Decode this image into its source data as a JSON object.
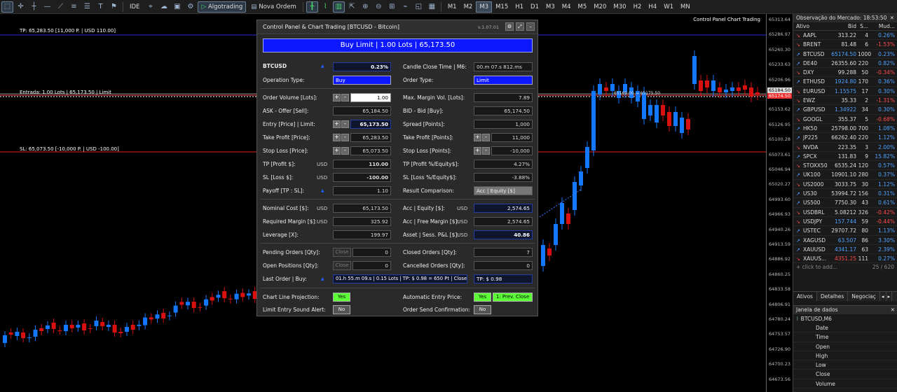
{
  "toolbar": {
    "algotrading": "Algotrading",
    "nova_ordem": "Nova Ordem",
    "ide": "IDE",
    "timeframes": [
      "M1",
      "M2",
      "M3",
      "M15",
      "H1",
      "D1",
      "M3",
      "M4",
      "M5",
      "M20",
      "M30",
      "H2",
      "H4",
      "W1",
      "MN"
    ],
    "active_timeframe": "M3"
  },
  "chart": {
    "title": "Control Panel Chart Trading",
    "tp_line": "TP: 65,283.50 [11,000 P. | USD 110.00]",
    "entry_line": "Entrada: 1.00 Lots | 65,173.50 | Limit",
    "sl_line": "SL: 65,073.50 [-10,000 P. | USD -100.00]",
    "marker_text": "65169.00 → 65175.50",
    "price_labels": [
      "65313.64",
      "65286.97",
      "65260.30",
      "65233.63",
      "65206.96",
      "65180.29",
      "65153.62",
      "65126.95",
      "65100.28",
      "65073.61",
      "65046.94",
      "65020.27",
      "64993.60",
      "64966.93",
      "64940.26",
      "64913.59",
      "64886.92",
      "64860.25",
      "64833.58",
      "64806.91",
      "64780.24",
      "64753.57",
      "64726.90",
      "64700.23",
      "64673.56"
    ],
    "tag_bid": "65184.50",
    "tag_ask": "65174.50"
  },
  "panel": {
    "title": "Control Panel & Chart Trading [BTCUSD - Bitcoin]",
    "version": "v.1.07.01",
    "main_button": "Buy Limit  |  1.00 Lots  |  65,173.50",
    "symbol": "BTCUSD",
    "change": "0.23%",
    "candle_close_label": "Candle Close Time | M6:",
    "candle_close_value": "00.m 07.s 812.ms",
    "operation_type_label": "Operation Type:",
    "operation_type_value": "Buy",
    "order_type_label": "Order Type:",
    "order_type_value": "Limit",
    "order_volume_label": "Order Volume [Lots]:",
    "order_volume_value": "1.00",
    "max_margin_label": "Max. Margin Vol. [Lots]:",
    "max_margin_value": "7.89",
    "ask_label": "ASK - Offer [Sell]:",
    "ask_value": "65,184.50",
    "bid_label": "BID - Bid [Buy]:",
    "bid_value": "65,174.50",
    "entry_label": "Entry [Price] | Limit:",
    "entry_value": "65,173.50",
    "spread_label": "Spread [Points]:",
    "spread_value": "1,000",
    "tp_price_label": "Take Profit [Price]:",
    "tp_price_value": "65,283.50",
    "tp_points_label": "Take Profit [Points]:",
    "tp_points_value": "11,000",
    "sl_price_label": "Stop Loss [Price]:",
    "sl_price_value": "65,073.50",
    "sl_points_label": "Stop Loss [Points]:",
    "sl_points_value": "-10,000",
    "tp_profit_label": "TP [Profit $]:",
    "tp_profit_value": "110.00",
    "tp_pct_label": "TP [Profit %/Equity$]:",
    "tp_pct_value": "4.27%",
    "sl_loss_label": "SL [Loss $]:",
    "sl_loss_value": "-100.00",
    "sl_pct_label": "SL [Loss %/Equity$]:",
    "sl_pct_value": "-3.88%",
    "payoff_label": "Payoff [TP : SL]:",
    "payoff_value": "1.10",
    "result_comp_label": "Result Comparison:",
    "result_comp_value": "Acc | Equity [$]",
    "nominal_label": "Nominal Cost [$]:",
    "nominal_value": "65,173.50",
    "acc_equity_label": "Acc | Equity [$]:",
    "acc_equity_value": "2,574.65",
    "req_margin_label": "Required Margin [$]:",
    "req_margin_value": "325.92",
    "free_margin_label": "Acc | Free Margin [$]:",
    "free_margin_value": "2,574.65",
    "leverage_label": "Leverage [X]:",
    "leverage_value": "199.97",
    "asset_pl_label": "Asset | Sess. P&L [$]:",
    "asset_pl_value": "40.86",
    "pending_label": "Pending Orders [Qty]:",
    "pending_value": "0",
    "closed_label": "Closed Orders [Qty]:",
    "closed_value": "7",
    "open_pos_label": "Open Positions [Qty]:",
    "open_pos_value": "0",
    "cancelled_label": "Cancelled Orders [Qty]:",
    "cancelled_value": "0",
    "last_order_label": "Last Order | Buy:",
    "last_order_value": "01.h 55.m 09.s | 0.15 Lots | TP: $ 0.98 = 650 Pt | Closed",
    "last_order_tp": "TP: $ 0.98",
    "line_proj_label": "Chart Line Projection:",
    "line_proj_value": "Yes",
    "auto_entry_label": "Automatic Entry Price:",
    "auto_entry_value": "Yes",
    "auto_entry_mode": "1: Prev. Close",
    "sound_label": "Limit Entry Sound Alert:",
    "sound_value": "No",
    "confirm_label": "Order Send Confirmation:",
    "confirm_value": "No",
    "close_btn": "Close",
    "usd": "USD"
  },
  "market": {
    "header": "Observação do Mercado: 18:53:50",
    "columns": [
      "Ativo",
      "Bid",
      "S...",
      "Mud..."
    ],
    "rows": [
      {
        "dir": "down",
        "sym": "AAPL",
        "bid": "313.22",
        "s": "4",
        "chg": "0.26%",
        "bidc": "wht",
        "chgc": "up"
      },
      {
        "dir": "down",
        "sym": "BRENT",
        "bid": "81.48",
        "s": "6",
        "chg": "-1.53%",
        "bidc": "wht",
        "chgc": "dn"
      },
      {
        "dir": "up",
        "sym": "BTCUSD",
        "bid": "65174.50",
        "s": "1000",
        "chg": "0.23%",
        "bidc": "up",
        "chgc": "up"
      },
      {
        "dir": "up",
        "sym": "DE40",
        "bid": "26355.60",
        "s": "220",
        "chg": "0.82%",
        "bidc": "wht",
        "chgc": "up"
      },
      {
        "dir": "down",
        "sym": "DXY",
        "bid": "99.288",
        "s": "50",
        "chg": "-0.34%",
        "bidc": "wht",
        "chgc": "dn"
      },
      {
        "dir": "up",
        "sym": "ETHUSD",
        "bid": "1924.80",
        "s": "170",
        "chg": "0.36%",
        "bidc": "up",
        "chgc": "up"
      },
      {
        "dir": "down",
        "sym": "EURUSD",
        "bid": "1.15575",
        "s": "17",
        "chg": "0.30%",
        "bidc": "up",
        "chgc": "up"
      },
      {
        "dir": "down",
        "sym": "EWZ",
        "bid": "35.33",
        "s": "2",
        "chg": "-1.31%",
        "bidc": "wht",
        "chgc": "dn"
      },
      {
        "dir": "up",
        "sym": "GBPUSD",
        "bid": "1.34922",
        "s": "34",
        "chg": "0.30%",
        "bidc": "up",
        "chgc": "up"
      },
      {
        "dir": "down",
        "sym": "GOOGL",
        "bid": "355.37",
        "s": "5",
        "chg": "-0.68%",
        "bidc": "wht",
        "chgc": "dn"
      },
      {
        "dir": "up",
        "sym": "HK50",
        "bid": "25798.00",
        "s": "700",
        "chg": "1.08%",
        "bidc": "wht",
        "chgc": "up"
      },
      {
        "dir": "up",
        "sym": "JP225",
        "bid": "66262.40",
        "s": "220",
        "chg": "1.12%",
        "bidc": "wht",
        "chgc": "up"
      },
      {
        "dir": "down",
        "sym": "NVDA",
        "bid": "223.35",
        "s": "3",
        "chg": "2.00%",
        "bidc": "wht",
        "chgc": "up"
      },
      {
        "dir": "up",
        "sym": "SPCX",
        "bid": "131.83",
        "s": "9",
        "chg": "15.82%",
        "bidc": "wht",
        "chgc": "up"
      },
      {
        "dir": "down",
        "sym": "STOXX50",
        "bid": "6535.24",
        "s": "120",
        "chg": "0.57%",
        "bidc": "wht",
        "chgc": "up"
      },
      {
        "dir": "up",
        "sym": "UK100",
        "bid": "10901.10",
        "s": "280",
        "chg": "0.37%",
        "bidc": "wht",
        "chgc": "up"
      },
      {
        "dir": "down",
        "sym": "US2000",
        "bid": "3033.75",
        "s": "30",
        "chg": "1.12%",
        "bidc": "wht",
        "chgc": "up"
      },
      {
        "dir": "up",
        "sym": "US30",
        "bid": "53994.72",
        "s": "156",
        "chg": "0.31%",
        "bidc": "wht",
        "chgc": "up"
      },
      {
        "dir": "up",
        "sym": "US500",
        "bid": "7750.30",
        "s": "43",
        "chg": "0.61%",
        "bidc": "wht",
        "chgc": "up"
      },
      {
        "dir": "down",
        "sym": "USDBRL",
        "bid": "5.08212",
        "s": "326",
        "chg": "-0.42%",
        "bidc": "wht",
        "chgc": "dn"
      },
      {
        "dir": "down",
        "sym": "USDJPY",
        "bid": "157.744",
        "s": "59",
        "chg": "-0.44%",
        "bidc": "up",
        "chgc": "dn"
      },
      {
        "dir": "up",
        "sym": "USTEC",
        "bid": "29707.72",
        "s": "80",
        "chg": "1.13%",
        "bidc": "wht",
        "chgc": "up"
      },
      {
        "dir": "up",
        "sym": "XAGUSD",
        "bid": "63.507",
        "s": "86",
        "chg": "3.30%",
        "bidc": "up",
        "chgc": "up"
      },
      {
        "dir": "up",
        "sym": "XAUUSD",
        "bid": "4341.17",
        "s": "63",
        "chg": "2.39%",
        "bidc": "up",
        "chgc": "up"
      },
      {
        "dir": "down",
        "sym": "XAUUS...",
        "bid": "4351.25",
        "s": "111",
        "chg": "0.27%",
        "bidc": "dn",
        "chgc": "up"
      }
    ],
    "add_text": "click to add...",
    "count": "25 / 620",
    "tabs": [
      "Ativos",
      "Detalhes",
      "Negociaç"
    ]
  },
  "datawindow": {
    "header": "Janela de dados",
    "symbol": "BTCUSD,M6",
    "rows": [
      "Date",
      "Time",
      "Open",
      "High",
      "Low",
      "Close",
      "Volume"
    ]
  }
}
